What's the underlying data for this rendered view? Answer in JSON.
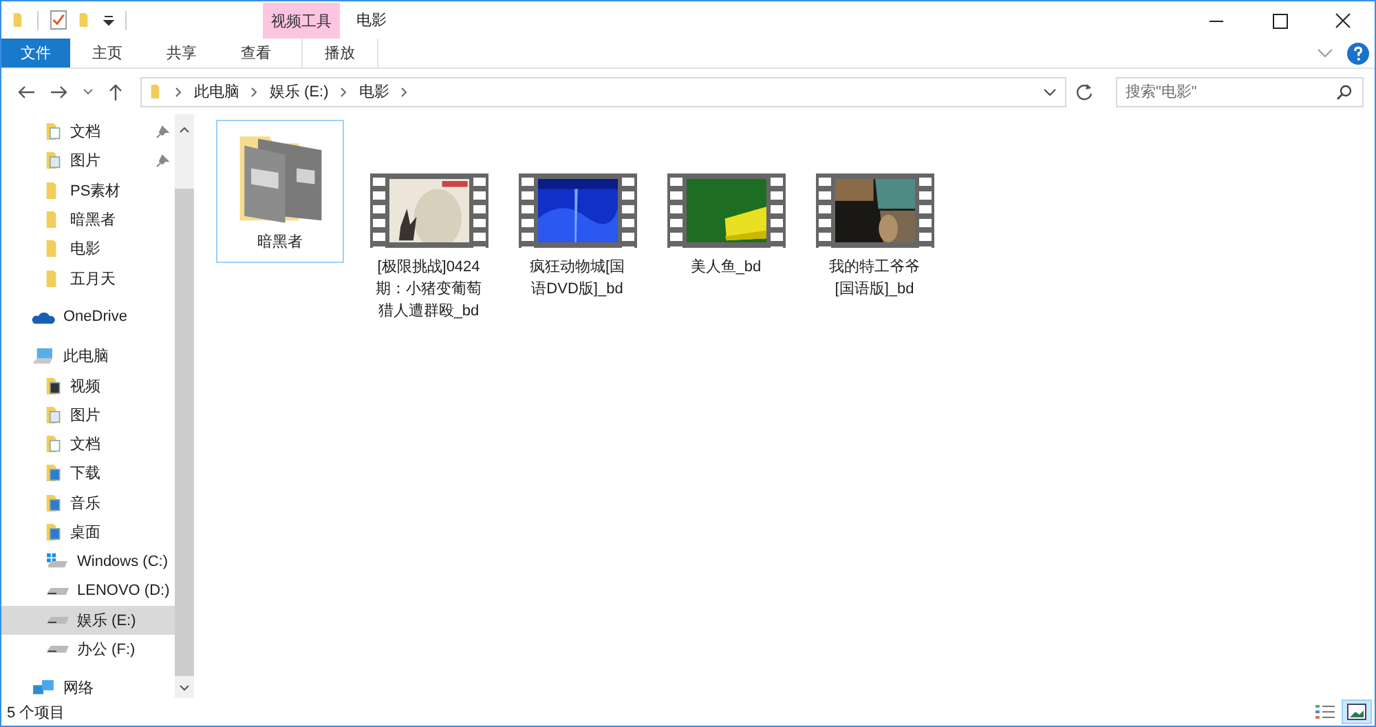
{
  "window": {
    "title": "电影",
    "context_tab_group": "视频工具"
  },
  "ribbon_tabs": [
    {
      "label": "文件",
      "kind": "file",
      "selected": false
    },
    {
      "label": "主页",
      "kind": "tab",
      "selected": false
    },
    {
      "label": "共享",
      "kind": "tab",
      "selected": false
    },
    {
      "label": "查看",
      "kind": "tab",
      "selected": false
    },
    {
      "label": "播放",
      "kind": "context",
      "selected": false
    }
  ],
  "address": {
    "crumbs": [
      "此电脑",
      "娱乐 (E:)",
      "电影"
    ]
  },
  "search": {
    "placeholder": "搜索\"电影\""
  },
  "sidebar": {
    "items": [
      {
        "label": "文档",
        "kind": "documents",
        "pinned": true,
        "selected": false
      },
      {
        "label": "图片",
        "kind": "pictures",
        "pinned": true,
        "selected": false
      },
      {
        "label": "PS素材",
        "kind": "folder",
        "pinned": false,
        "selected": false
      },
      {
        "label": "暗黑者",
        "kind": "folder",
        "pinned": false,
        "selected": false
      },
      {
        "label": "电影",
        "kind": "folder",
        "pinned": false,
        "selected": false
      },
      {
        "label": "五月天",
        "kind": "folder",
        "pinned": false,
        "selected": false
      },
      {
        "label": "OneDrive",
        "kind": "cloud",
        "selected": false
      },
      {
        "label": "此电脑",
        "kind": "computer",
        "selected": false,
        "children": [
          {
            "label": "视频",
            "kind": "videos",
            "selected": false
          },
          {
            "label": "图片",
            "kind": "pictures",
            "selected": false
          },
          {
            "label": "文档",
            "kind": "documents",
            "selected": false
          },
          {
            "label": "下载",
            "kind": "downloads",
            "selected": false
          },
          {
            "label": "音乐",
            "kind": "music",
            "selected": false
          },
          {
            "label": "桌面",
            "kind": "desktop",
            "selected": false
          },
          {
            "label": "Windows (C:)",
            "kind": "system-drive",
            "selected": false
          },
          {
            "label": "LENOVO (D:)",
            "kind": "drive",
            "selected": false
          },
          {
            "label": "娱乐 (E:)",
            "kind": "drive",
            "selected": true
          },
          {
            "label": "办公 (F:)",
            "kind": "drive",
            "selected": false
          }
        ]
      },
      {
        "label": "网络",
        "kind": "network",
        "selected": false
      }
    ]
  },
  "files": [
    {
      "name": "暗黑者",
      "kind": "folder",
      "selected": true
    },
    {
      "name": "[极限挑战]0424期：小猪变葡萄猎人遭群殴_bd",
      "kind": "video",
      "selected": false
    },
    {
      "name": "疯狂动物城[国语DVD版]_bd",
      "kind": "video",
      "selected": false
    },
    {
      "name": "美人鱼_bd",
      "kind": "video",
      "selected": false
    },
    {
      "name": "我的特工爷爷[国语版]_bd",
      "kind": "video",
      "selected": false
    }
  ],
  "status_bar": {
    "item_count": "5 个项目"
  }
}
